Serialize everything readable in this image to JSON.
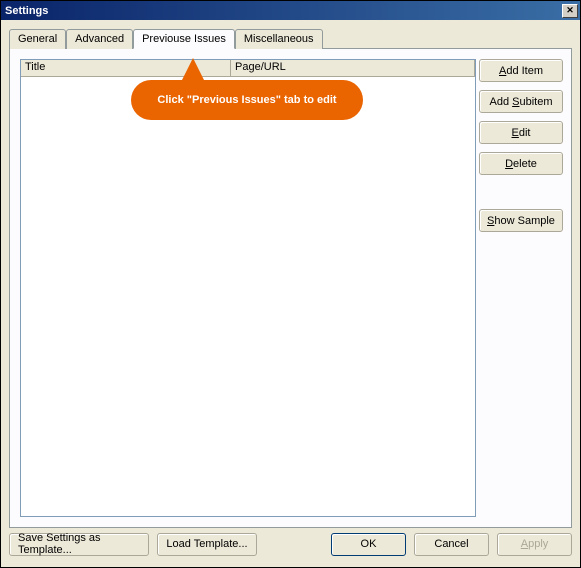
{
  "window": {
    "title": "Settings"
  },
  "tabs": {
    "general": "General",
    "advanced": "Advanced",
    "previouse_issues": "Previouse Issues",
    "miscellaneous": "Miscellaneous"
  },
  "columns": {
    "title": "Title",
    "page_url": "Page/URL"
  },
  "buttons": {
    "add_item": "dd Item",
    "add_item_u": "A",
    "add_subitem": "ubitem",
    "add_subitem_pre": "Add ",
    "add_subitem_u": "S",
    "edit": "dit",
    "edit_u": "E",
    "delete": "elete",
    "delete_u": "D",
    "show_sample": "how Sample",
    "show_sample_u": "S",
    "save_template": "Save Settings as Template...",
    "load_template": "Load Template...",
    "ok": "OK",
    "cancel": "Cancel",
    "apply": "pply",
    "apply_u": "A"
  },
  "callout": {
    "text": "Click \"Previous Issues\" tab to edit"
  }
}
